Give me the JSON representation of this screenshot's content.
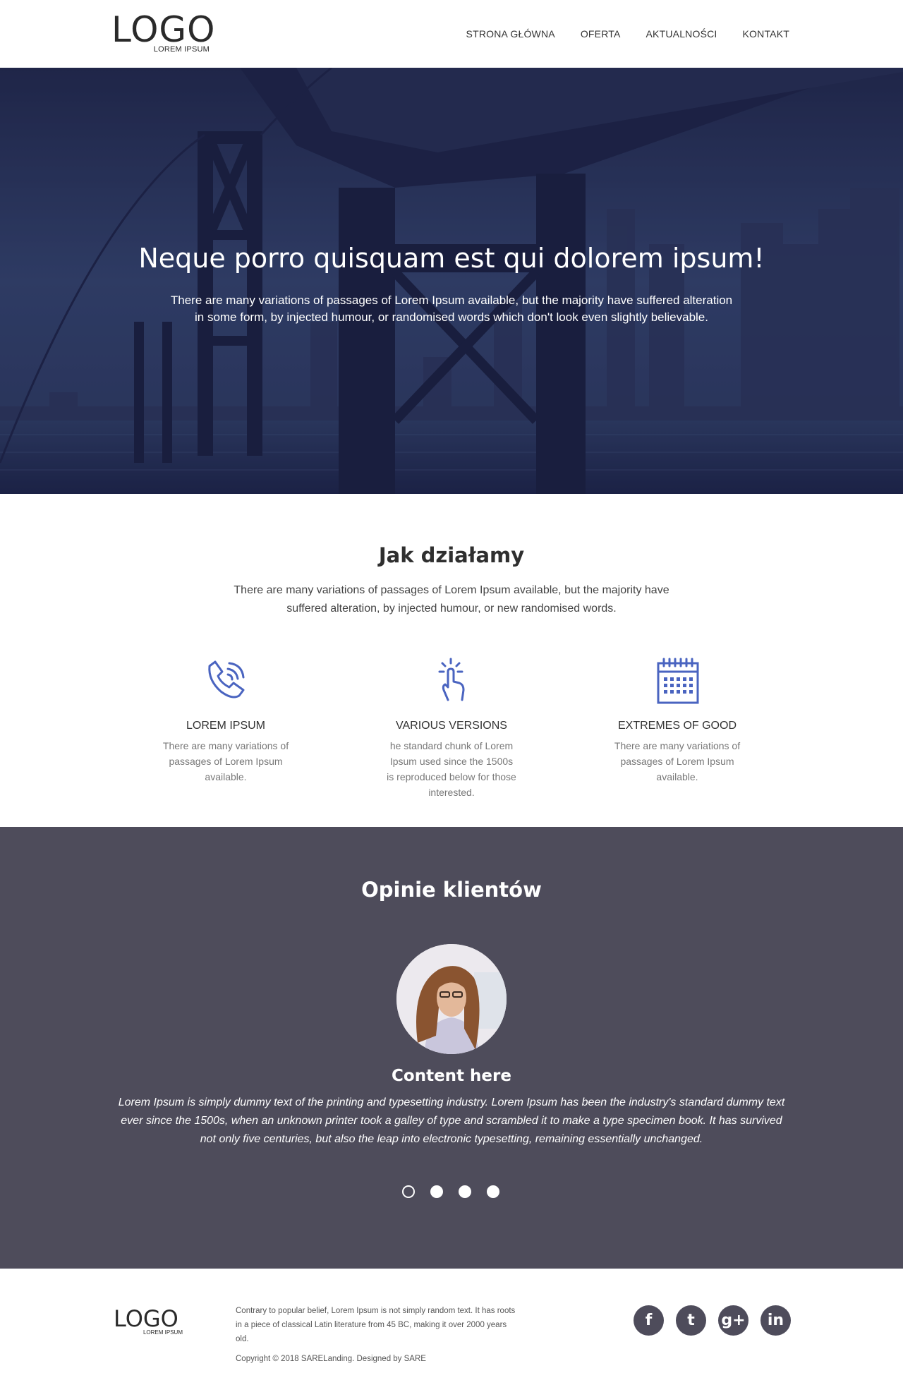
{
  "header": {
    "logo": "LOGO",
    "logo_sub": "LOREM IPSUM",
    "nav": [
      "STRONA GŁÓWNA",
      "OFERTA",
      "AKTUALNOŚCI",
      "KONTAKT"
    ]
  },
  "hero": {
    "title": "Neque porro quisquam est qui dolorem ipsum!",
    "text": "There are many variations of passages of Lorem Ipsum available, but the majority have suffered alteration in some form, by injected humour, or randomised words which don't look even slightly believable."
  },
  "how": {
    "title": "Jak działamy",
    "text": "There are many variations of passages of Lorem Ipsum available, but the majority have suffered alteration, by injected humour, or new randomised words.",
    "features": [
      {
        "icon": "phone-icon",
        "title": "LOREM IPSUM",
        "text": "There are many variations of passages of Lorem Ipsum available."
      },
      {
        "icon": "tap-hand-icon",
        "title": "VARIOUS VERSIONS",
        "text": "he standard chunk of Lorem Ipsum used since the 1500s is reproduced below for those interested."
      },
      {
        "icon": "calendar-icon",
        "title": "EXTREMES OF GOOD",
        "text": "There are many variations of passages of Lorem Ipsum available."
      }
    ]
  },
  "testimonials": {
    "title": "Opinie klientów",
    "name": "Content here",
    "quote": "Lorem Ipsum is simply dummy text of the printing and typesetting industry. Lorem Ipsum has been the industry's standard dummy text ever since the 1500s, when an unknown printer took a galley of type and scrambled it to make a type specimen book. It has survived not only five centuries, but also the leap into electronic typesetting, remaining essentially unchanged.",
    "slide_count": 4,
    "active_slide": 1
  },
  "footer": {
    "logo": "LOGO",
    "logo_sub": "LOREM IPSUM",
    "text": "Contrary to popular belief, Lorem Ipsum is not simply random text. It has roots in a piece of classical Latin literature from 45 BC, making it over 2000 years old.",
    "copyright": "Copyright © 2018 SARELanding. Designed by SARE",
    "socials": [
      {
        "icon": "facebook-icon",
        "glyph": "f"
      },
      {
        "icon": "twitter-icon",
        "glyph": "t"
      },
      {
        "icon": "google-plus-icon",
        "glyph": "g+"
      },
      {
        "icon": "linkedin-icon",
        "glyph": "in"
      }
    ]
  },
  "colors": {
    "accent_icon": "#4a64c0",
    "testimonial_bg": "#4e4c5b",
    "social_bg": "#4e4c5b"
  }
}
